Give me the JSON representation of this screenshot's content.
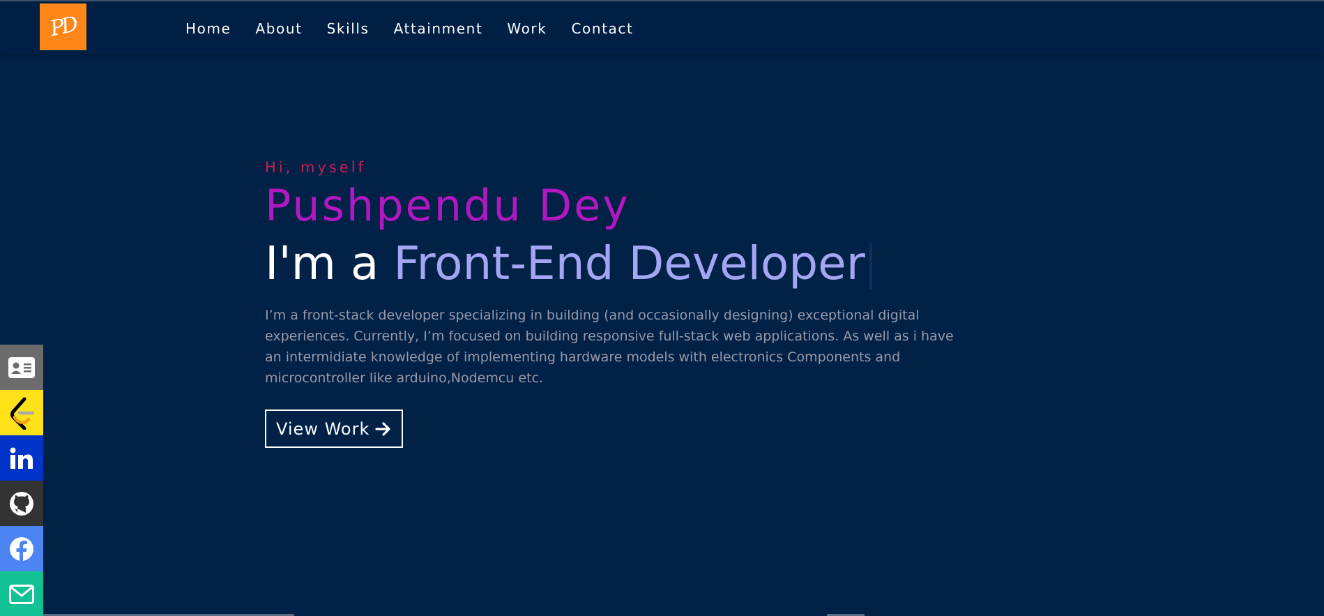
{
  "logo": {
    "text": "PD"
  },
  "nav": {
    "items": [
      {
        "label": "Home"
      },
      {
        "label": "About"
      },
      {
        "label": "Skills"
      },
      {
        "label": "Attainment"
      },
      {
        "label": "Work"
      },
      {
        "label": "Contact"
      }
    ]
  },
  "hero": {
    "greeting": "Hi, myself",
    "name": "Pushpendu Dey",
    "role_prefix": "I'm a",
    "role_typed": "Front-End Developer",
    "bio": "I’m a front-stack developer specializing in building (and occasionally designing) exceptional digital experiences. Currently, I’m focused on building responsive full-stack web applications. As well as i have an intermidiate knowledge of implementing hardware models with electronics Components and microcontroller like arduino,Nodemcu etc.",
    "cta_label": "View Work"
  },
  "social": {
    "items": [
      {
        "icon": "contact-card-icon",
        "color": "#6c6c6c"
      },
      {
        "icon": "leetcode-icon",
        "color": "#ffe21a"
      },
      {
        "icon": "linkedin-icon",
        "color": "#0034c9"
      },
      {
        "icon": "github-icon",
        "color": "#333333"
      },
      {
        "icon": "facebook-icon",
        "color": "#4c84f4"
      },
      {
        "icon": "mail-icon",
        "color": "#13c294"
      }
    ]
  },
  "colors": {
    "background": "#012147",
    "logo_bg": "#ff8618",
    "greeting": "#d01d55",
    "name": "#b118c1",
    "role_typed": "#a4a6f4"
  }
}
